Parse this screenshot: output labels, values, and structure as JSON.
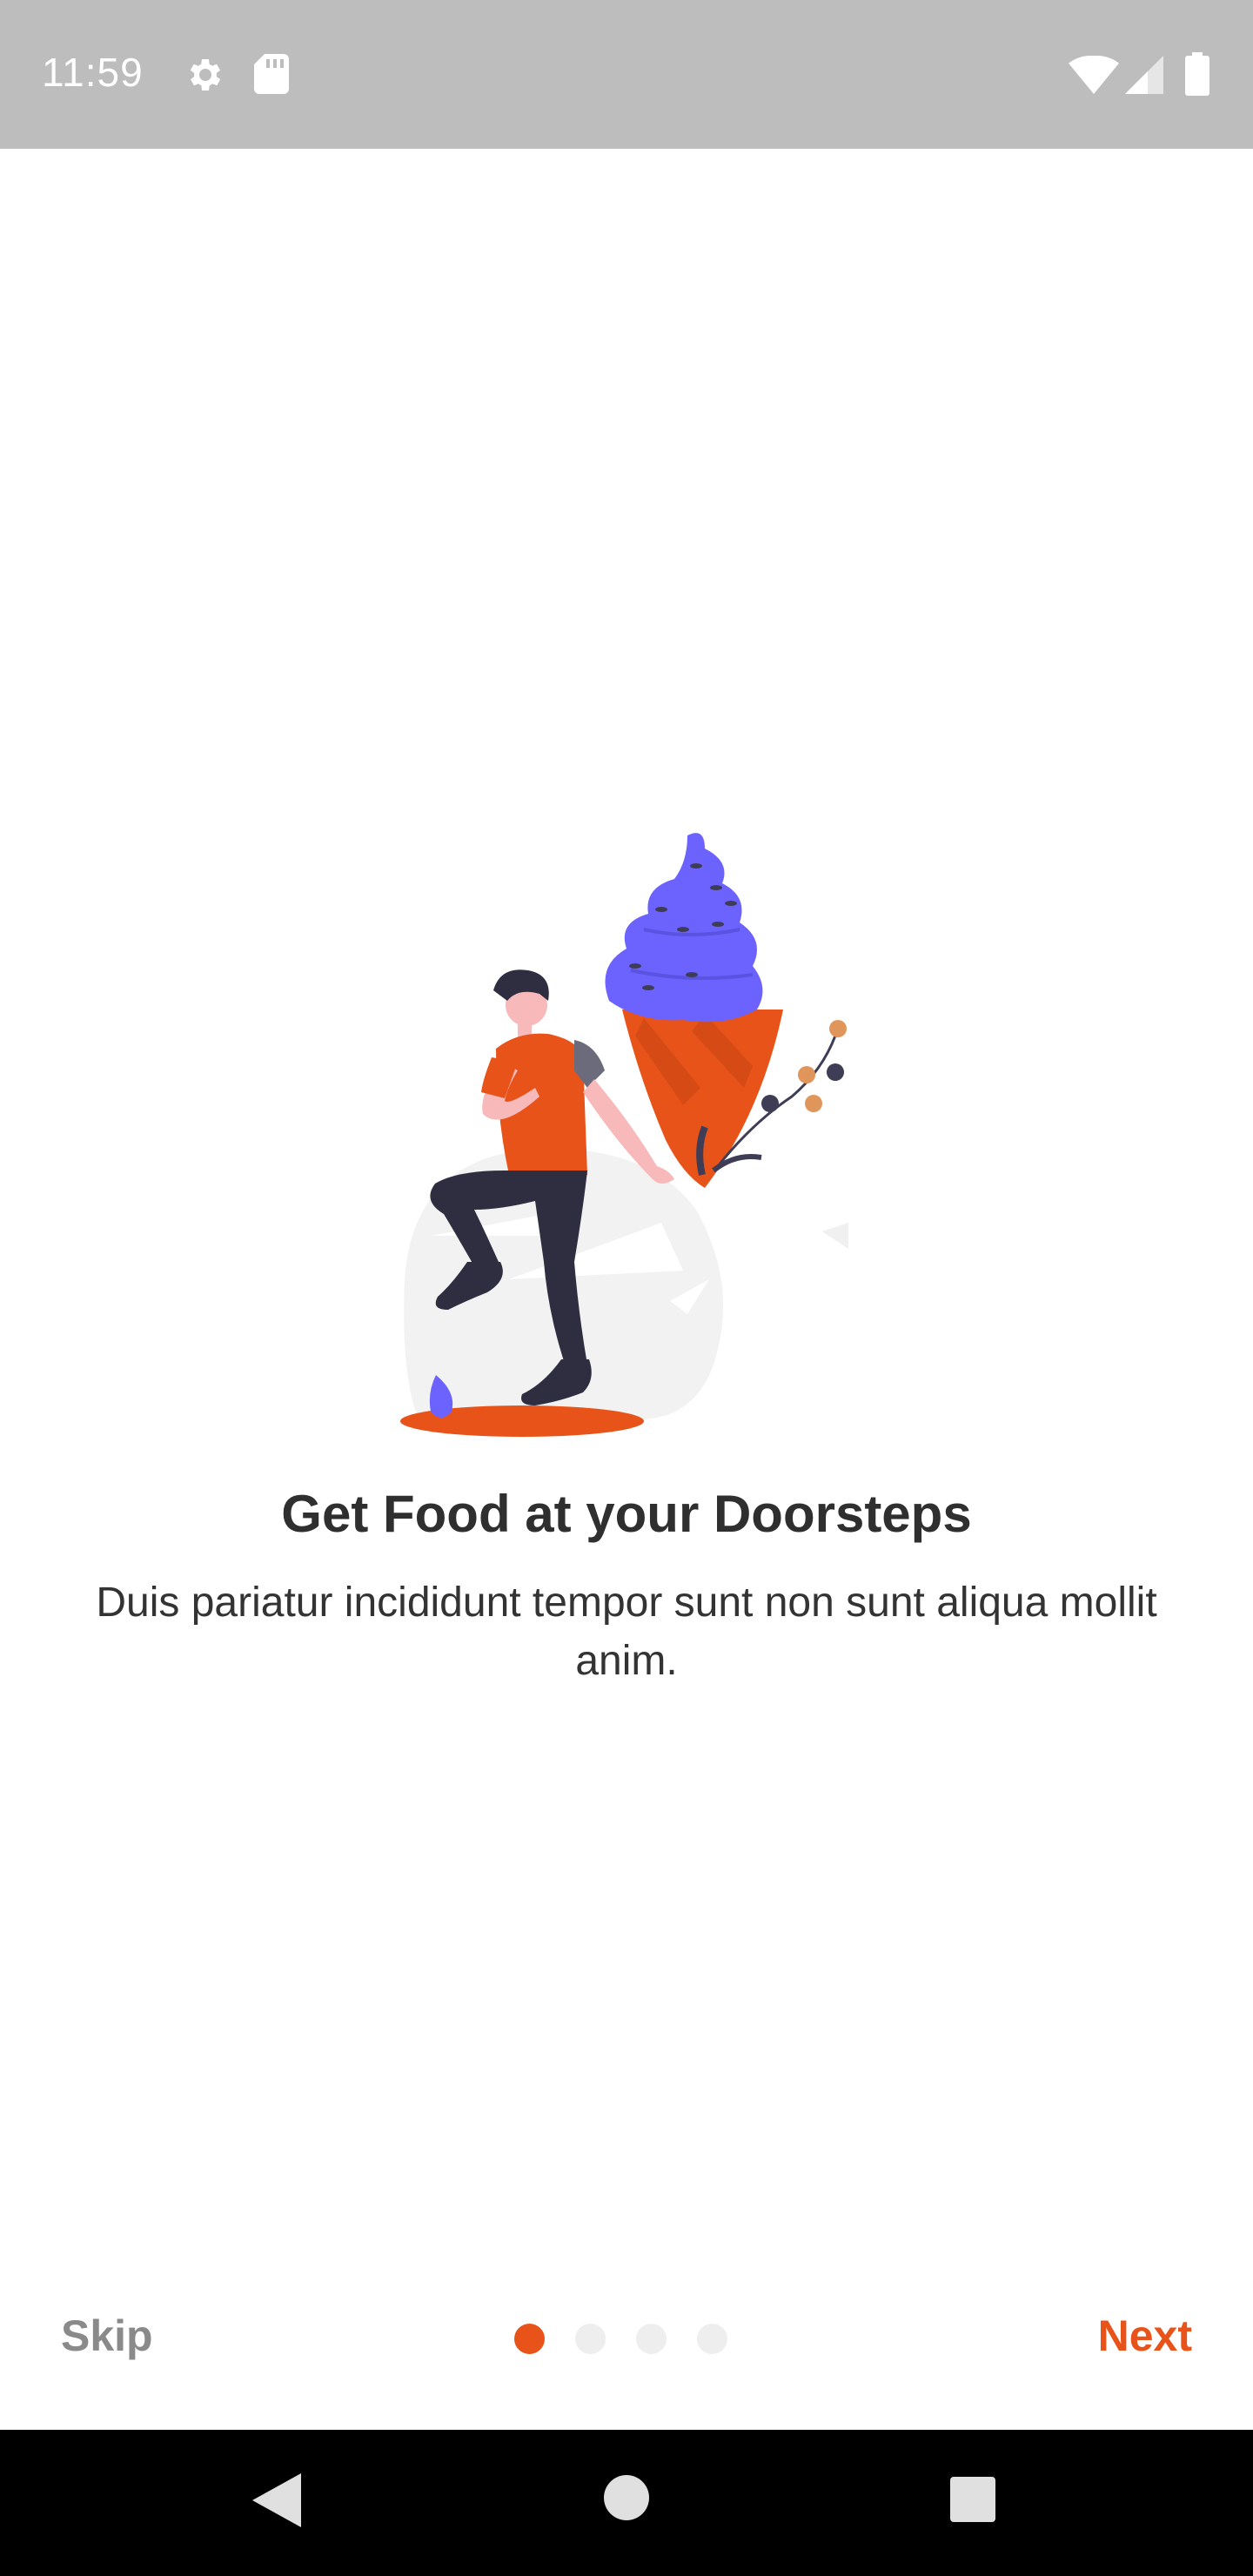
{
  "status_bar": {
    "time": "11:59",
    "icons": [
      "settings-icon",
      "sd-card-icon",
      "wifi-icon",
      "signal-icon",
      "battery-icon"
    ]
  },
  "onboarding": {
    "title": "Get Food at your Doorsteps",
    "subtitle": "Duis pariatur incididunt tempor sunt non sunt aliqua mollit anim.",
    "skip_label": "Skip",
    "next_label": "Next",
    "page_count": 4,
    "current_page": 1
  },
  "colors": {
    "accent": "#e8531a",
    "purple": "#6c63ff",
    "dark_text": "#2f2f2f",
    "muted": "#8a8a8a",
    "status_bar": "#bdbdbd"
  },
  "nav_bar": {
    "buttons": [
      "back-icon",
      "home-icon",
      "recents-icon"
    ]
  }
}
